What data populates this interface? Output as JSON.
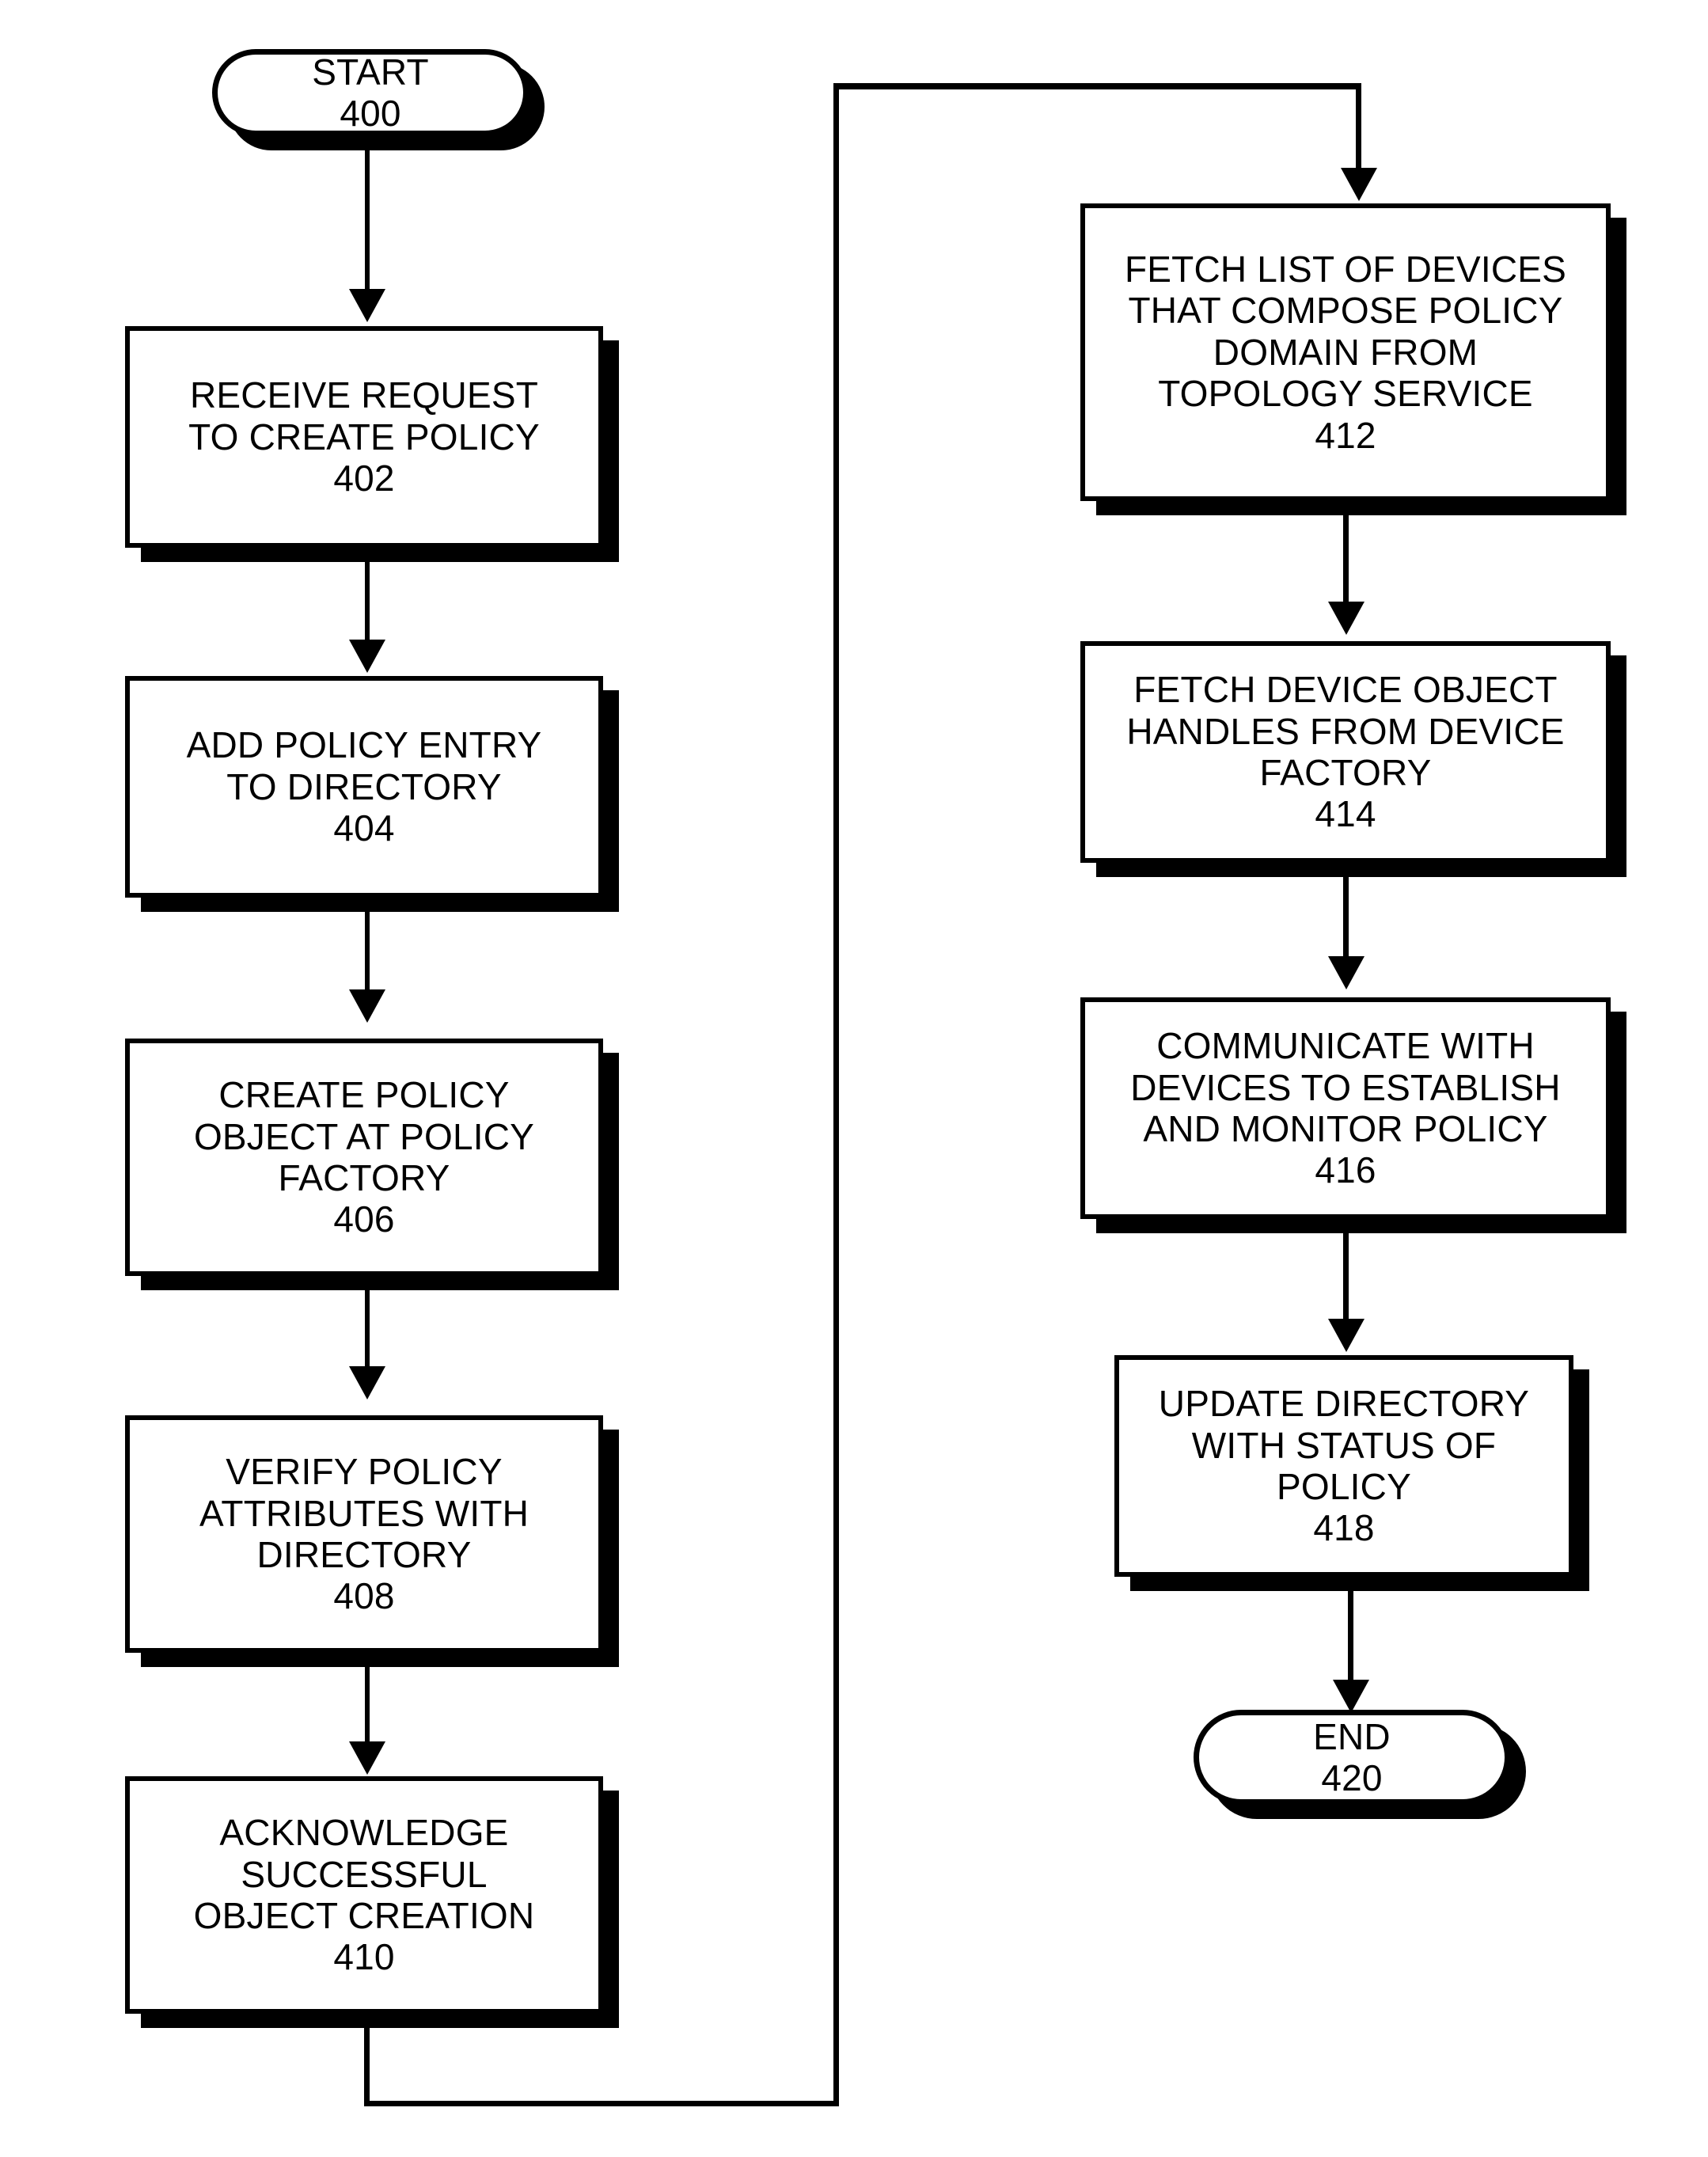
{
  "diagram": {
    "type": "flowchart",
    "title": "Policy creation flowchart",
    "orientation": "two-column, top-to-bottom with wrap connector"
  },
  "nodes": {
    "start": {
      "shape": "terminal",
      "lines": [
        "START",
        "400"
      ]
    },
    "n402": {
      "shape": "process",
      "lines": [
        "RECEIVE REQUEST",
        "TO CREATE POLICY",
        "402"
      ]
    },
    "n404": {
      "shape": "process",
      "lines": [
        "ADD POLICY ENTRY",
        "TO DIRECTORY",
        "404"
      ]
    },
    "n406": {
      "shape": "process",
      "lines": [
        "CREATE POLICY",
        "OBJECT AT POLICY",
        "FACTORY",
        "406"
      ]
    },
    "n408": {
      "shape": "process",
      "lines": [
        "VERIFY POLICY",
        "ATTRIBUTES WITH",
        "DIRECTORY",
        "408"
      ]
    },
    "n410": {
      "shape": "process",
      "lines": [
        "ACKNOWLEDGE",
        "SUCCESSFUL",
        "OBJECT CREATION",
        "410"
      ]
    },
    "n412": {
      "shape": "process",
      "lines": [
        "FETCH LIST OF DEVICES",
        "THAT COMPOSE POLICY",
        "DOMAIN FROM",
        "TOPOLOGY SERVICE",
        "412"
      ]
    },
    "n414": {
      "shape": "process",
      "lines": [
        "FETCH DEVICE OBJECT",
        "HANDLES FROM DEVICE",
        "FACTORY",
        "414"
      ]
    },
    "n416": {
      "shape": "process",
      "lines": [
        "COMMUNICATE WITH",
        "DEVICES TO ESTABLISH",
        "AND MONITOR POLICY",
        "416"
      ]
    },
    "n418": {
      "shape": "process",
      "lines": [
        "UPDATE DIRECTORY",
        "WITH STATUS OF",
        "POLICY",
        "418"
      ]
    },
    "end": {
      "shape": "terminal",
      "lines": [
        "END",
        "420"
      ]
    }
  },
  "edges": [
    {
      "from": "start",
      "to": "n402",
      "style": "straight-down-arrow"
    },
    {
      "from": "n402",
      "to": "n404",
      "style": "straight-down-arrow"
    },
    {
      "from": "n404",
      "to": "n406",
      "style": "straight-down-arrow"
    },
    {
      "from": "n406",
      "to": "n408",
      "style": "straight-down-arrow"
    },
    {
      "from": "n408",
      "to": "n410",
      "style": "straight-down-arrow"
    },
    {
      "from": "n410",
      "to": "n412",
      "style": "wrap-connector-down-right-up-right-down-arrow"
    },
    {
      "from": "n412",
      "to": "n414",
      "style": "straight-down-arrow"
    },
    {
      "from": "n414",
      "to": "n416",
      "style": "straight-down-arrow"
    },
    {
      "from": "n416",
      "to": "n418",
      "style": "straight-down-arrow"
    },
    {
      "from": "n418",
      "to": "end",
      "style": "straight-down-arrow"
    }
  ],
  "colors": {
    "stroke": "#000000",
    "fill": "#ffffff",
    "shadow": "#000000"
  }
}
